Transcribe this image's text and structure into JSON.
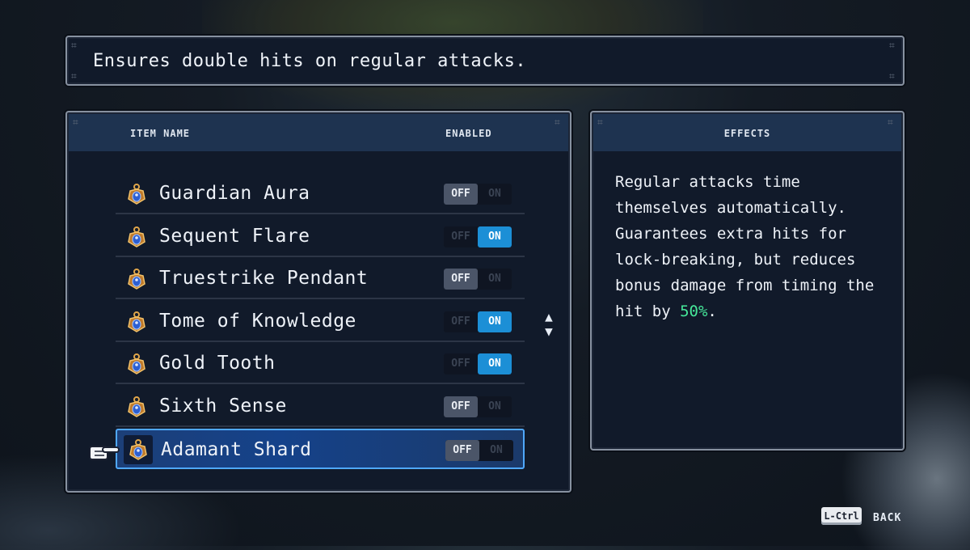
{
  "description": "Ensures double hits on regular attacks.",
  "list": {
    "header_name": "ITEM NAME",
    "header_enabled": "ENABLED",
    "toggle_off_label": "OFF",
    "toggle_on_label": "ON",
    "items": [
      {
        "name": "Guardian Aura",
        "enabled": false
      },
      {
        "name": "Sequent Flare",
        "enabled": true
      },
      {
        "name": "Truestrike Pendant",
        "enabled": false
      },
      {
        "name": "Tome of Knowledge",
        "enabled": true
      },
      {
        "name": "Gold Tooth",
        "enabled": true
      },
      {
        "name": "Sixth Sense",
        "enabled": false
      },
      {
        "name": "Adamant Shard",
        "enabled": false,
        "selected": true
      }
    ],
    "icon": "relic-amulet-icon"
  },
  "effects": {
    "header": "EFFECTS",
    "text_before": "Regular attacks time themselves automatically. Guarantees extra hits for lock-breaking, but reduces bonus damage from timing the hit by ",
    "highlight": "50%",
    "text_after": "."
  },
  "footer": {
    "key_label": "L-Ctrl",
    "back_label": "BACK"
  },
  "colors": {
    "panel_bg": "#111a2a",
    "header_bg": "#1e3350",
    "toggle_on": "#1c8fd6",
    "toggle_off": "#4b5568",
    "highlight": "#46e89a",
    "selection_border": "#4fa8ff"
  }
}
